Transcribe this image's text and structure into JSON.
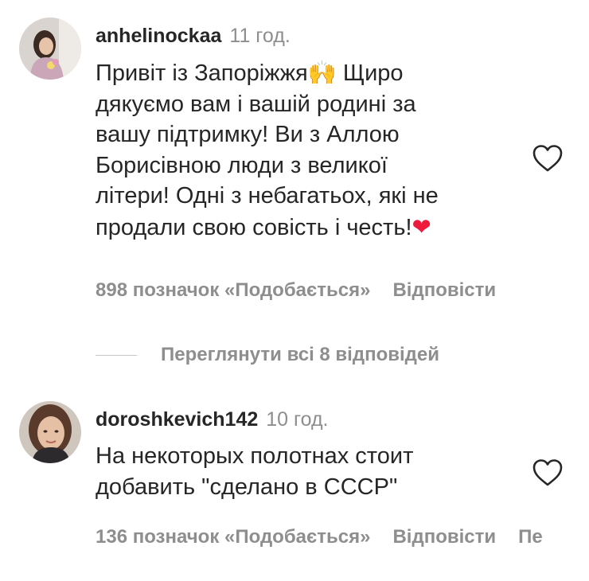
{
  "comments": [
    {
      "username": "anhelinockaa",
      "time": "11 год.",
      "lines": [
        "Привіт із Запоріжжя",
        "дякуємо вам і вашій родині за",
        "вашу підтримку! Ви з Аллою",
        "Борисівною люди з великої",
        "літери! Одні з небагатьох, які не",
        "продали свою совість і честь!"
      ],
      "line1_after_emoji": " Щиро",
      "likes": "898 позначок «Подобається»",
      "reply": "Відповісти",
      "avatar_icon": "profile-photo",
      "like_icon": "heart-outline-icon",
      "emojis": [
        "raising-hands-emoji",
        "red-heart-emoji"
      ]
    },
    {
      "username": "doroshkevich142",
      "time": "10 год.",
      "lines": [
        "На некоторых полотнах стоит",
        "добавить \"сделано в СССР\""
      ],
      "likes": "136 позначок «Подобається»",
      "reply": "Відповісти",
      "more_cut": "Пе",
      "avatar_icon": "profile-photo",
      "like_icon": "heart-outline-icon"
    }
  ],
  "view_replies": "Переглянути всі 8 відповідей",
  "colors": {
    "text": "#262626",
    "secondary": "#8e8e8e",
    "divider": "#c7c7c7",
    "heart_emoji": "#ed1c3c"
  }
}
